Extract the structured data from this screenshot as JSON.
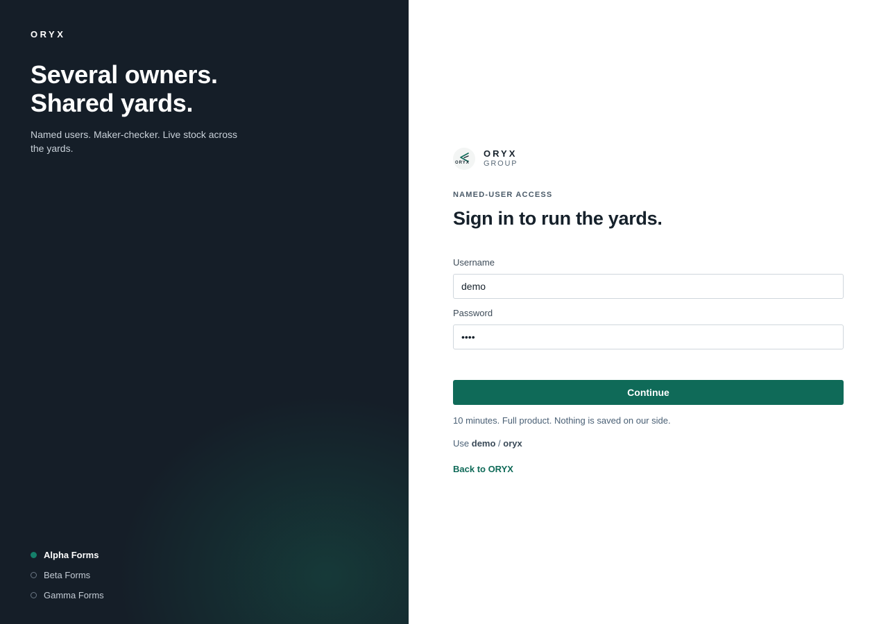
{
  "brand": "ORYX",
  "hero": {
    "line1": "Several owners.",
    "line2": "Shared yards.",
    "subtitle": "Named users. Maker-checker. Live stock across the yards."
  },
  "forms": [
    {
      "label": "Alpha Forms",
      "active": true
    },
    {
      "label": "Beta Forms",
      "active": false
    },
    {
      "label": "Gamma Forms",
      "active": false
    }
  ],
  "logo": {
    "name": "ORYX",
    "group": "GROUP",
    "mark_text": "ORYX"
  },
  "signin": {
    "eyebrow": "NAMED-USER ACCESS",
    "title": "Sign in to run the yards.",
    "username_label": "Username",
    "username_value": "demo",
    "password_label": "Password",
    "password_value": "oryx",
    "continue_label": "Continue",
    "note": "10 minutes. Full product. Nothing is saved on our side.",
    "creds_prefix": "Use",
    "creds_user": "demo",
    "creds_sep": "/",
    "creds_pass": "oryx",
    "back_label": "Back to ORYX"
  },
  "colors": {
    "left_bg": "#151e28",
    "accent": "#0f6a58"
  },
  "icons": {
    "logo": "oryx-logo-icon",
    "active_dot": "filled-dot-icon",
    "inactive_dot": "hollow-dot-icon"
  }
}
